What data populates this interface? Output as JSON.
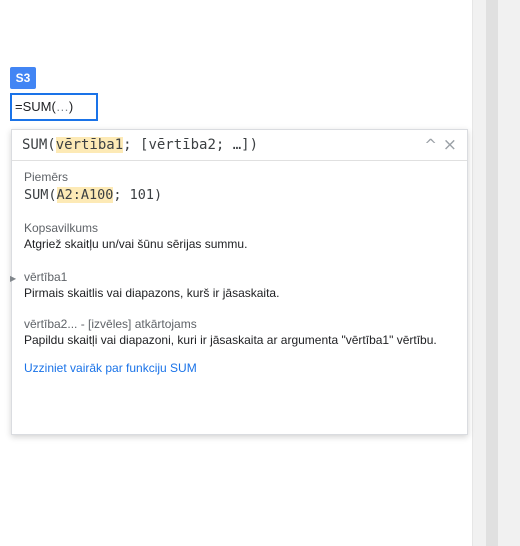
{
  "cell": {
    "label": "S3",
    "formula_text": "=SUM(",
    "formula_ellipsis": "…",
    "formula_close": ")"
  },
  "help": {
    "signature": {
      "fn": "SUM(",
      "arg1": "vērtība1",
      "rest": "; [vērtība2; …])"
    },
    "controls": {
      "collapse": "^",
      "close": "×"
    },
    "example": {
      "title": "Piemērs",
      "fn": "SUM(",
      "range": "A2:A100",
      "rest": "; 101)"
    },
    "summary": {
      "title": "Kopsavilkums",
      "text": "Atgriež skaitļu un/vai šūnu sērijas summu."
    },
    "arg1": {
      "name": "vērtība1",
      "desc": "Pirmais skaitlis vai diapazons, kurš ir jāsaskaita."
    },
    "arg2": {
      "name": "vērtība2... - [izvēles] atkārtojams",
      "desc": "Papildu skaitļi vai diapazoni, kuri ir jāsaskaita ar argumenta \"vērtība1\" vērtību."
    },
    "learn_more": "Uzziniet vairāk par funkciju SUM"
  },
  "colors": {
    "accent": "#4285f4",
    "editor_border": "#1a73e8",
    "highlight": "#fdeab6",
    "link": "#1a73e8"
  }
}
